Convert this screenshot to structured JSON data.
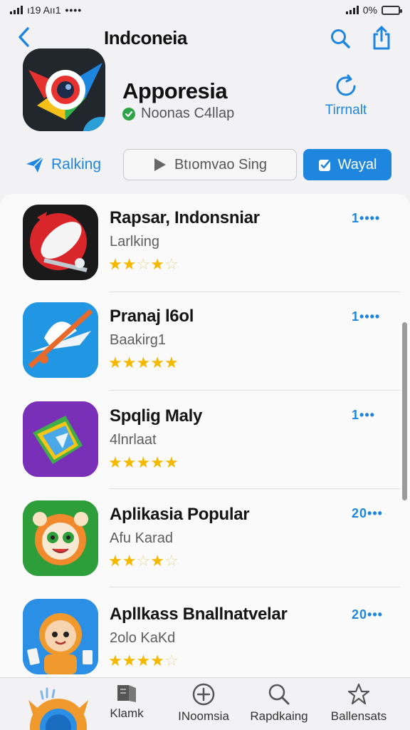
{
  "status": {
    "left_text": "ı19 Aıı1",
    "dots": "••••",
    "battery_text": "0%"
  },
  "nav": {
    "title": "Indconeia"
  },
  "hero": {
    "name": "Apporesia",
    "subtitle": "Noonas C4llap",
    "action_label": "Tirrnalt"
  },
  "filters": {
    "ranking_label": "Ralking",
    "browse_label": "Btıomvao Sing",
    "wayal_label": "Wayal"
  },
  "apps": [
    {
      "title": "Rapsar, Indonsniar",
      "subtitle": "Larlking",
      "rank": "1••••",
      "stars": "★★☆★☆",
      "rating": 2.5
    },
    {
      "title": "Pranaj l6ol",
      "subtitle": "Baakirg1",
      "rank": "1••••",
      "stars": "★★★★★",
      "rating": 5
    },
    {
      "title": "Spqlig Maly",
      "subtitle": "4lnrlaat",
      "rank": "1•••",
      "stars": "★★★★★",
      "rating": 4.5
    },
    {
      "title": "Aplikasia Popular",
      "subtitle": "Afu Karad",
      "rank": "20•••",
      "stars": "★★☆★☆",
      "rating": 2.5
    },
    {
      "title": "Apllkass Bnallnatvelar",
      "subtitle": "2olo KaKd",
      "rank": "20•••",
      "stars": "★★★★☆",
      "rating": 4
    }
  ],
  "tabs": [
    {
      "label": "Klamk",
      "icon": "book-icon"
    },
    {
      "label": "INoomsia",
      "icon": "plus-circle-icon"
    },
    {
      "label": "Rapdkaing",
      "icon": "search-icon"
    },
    {
      "label": "Ballensats",
      "icon": "star-icon"
    }
  ],
  "colors": {
    "accent": "#1f86e0",
    "star": "#f5b800",
    "verified": "#2ca447"
  }
}
